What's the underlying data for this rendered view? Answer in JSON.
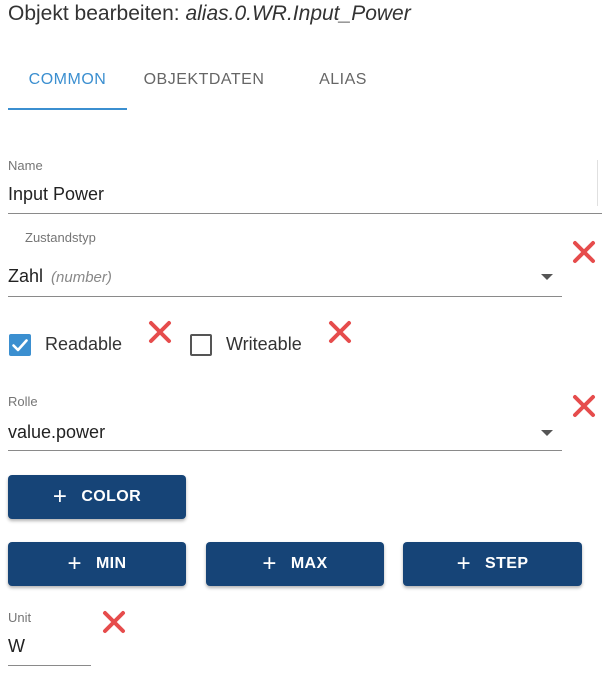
{
  "dialog": {
    "title_prefix": "Objekt bearbeiten:",
    "object_id": "alias.0.WR.Input_Power"
  },
  "tabs": [
    {
      "label": "COMMON",
      "active": true
    },
    {
      "label": "OBJEKTDATEN",
      "active": false
    },
    {
      "label": "ALIAS",
      "active": false
    }
  ],
  "fields": {
    "name": {
      "label": "Name",
      "value": "Input Power"
    },
    "type": {
      "label": "Zustandstyp",
      "value": "Zahl",
      "hint": "(number)"
    },
    "readable": {
      "label": "Readable",
      "checked": true
    },
    "writeable": {
      "label": "Writeable",
      "checked": false
    },
    "role": {
      "label": "Rolle",
      "value": "value.power"
    },
    "unit": {
      "label": "Unit",
      "value": "W"
    }
  },
  "buttons": {
    "plus_glyph": "+",
    "color": "COLOR",
    "min": "MIN",
    "max": "MAX",
    "step": "STEP"
  },
  "colors": {
    "accent": "#3b8fd0",
    "button": "#164477",
    "remove_icon": "#e64c4c"
  }
}
